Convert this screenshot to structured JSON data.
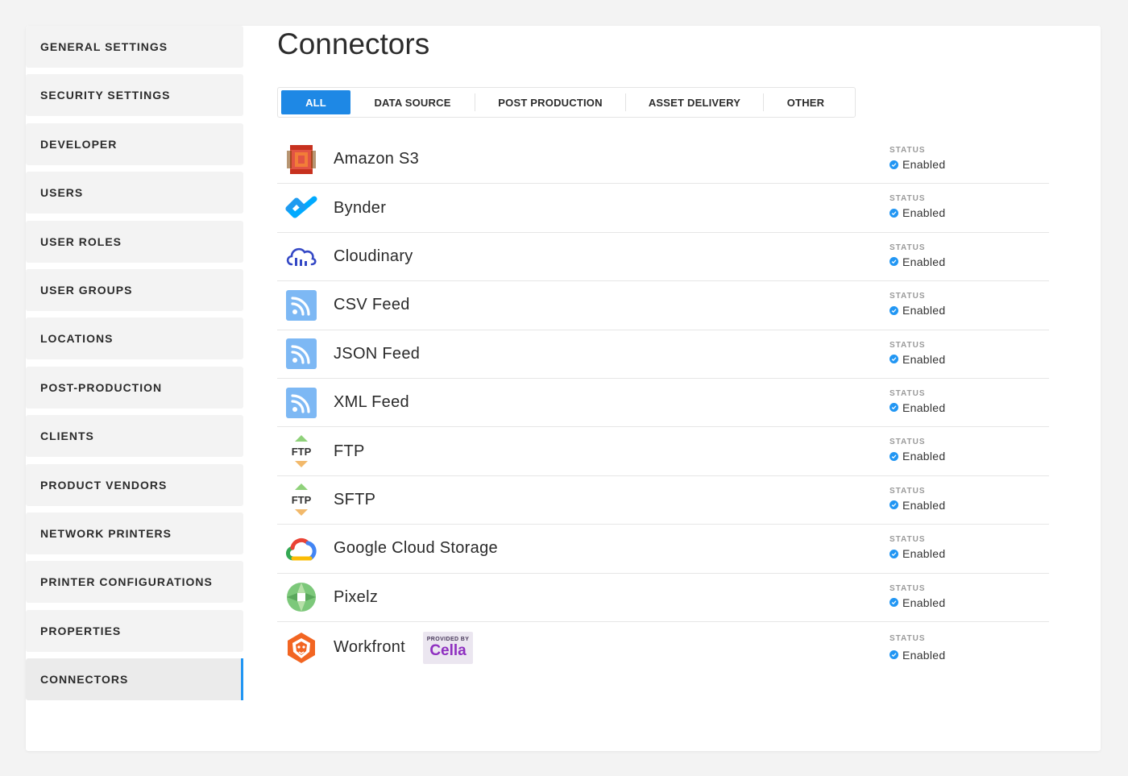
{
  "sidebar": {
    "items": [
      {
        "label": "GENERAL SETTINGS"
      },
      {
        "label": "SECURITY SETTINGS"
      },
      {
        "label": "DEVELOPER"
      },
      {
        "label": "USERS"
      },
      {
        "label": "USER ROLES"
      },
      {
        "label": "USER GROUPS"
      },
      {
        "label": "LOCATIONS"
      },
      {
        "label": "POST-PRODUCTION"
      },
      {
        "label": "CLIENTS"
      },
      {
        "label": "PRODUCT VENDORS"
      },
      {
        "label": "NETWORK PRINTERS"
      },
      {
        "label": "PRINTER CONFIGURATIONS"
      },
      {
        "label": "PROPERTIES"
      },
      {
        "label": "CONNECTORS"
      }
    ],
    "active": "CONNECTORS",
    "accent_color": "#2196f3"
  },
  "main": {
    "title": "Connectors",
    "tabs": [
      {
        "label": "ALL"
      },
      {
        "label": "DATA SOURCE"
      },
      {
        "label": "POST PRODUCTION"
      },
      {
        "label": "ASSET DELIVERY"
      },
      {
        "label": "OTHER"
      }
    ],
    "active_tab": "ALL",
    "connectors": [
      {
        "name": "Amazon S3",
        "icon": "amazon-s3-icon",
        "status_label": "STATUS",
        "status": "Enabled"
      },
      {
        "name": "Bynder",
        "icon": "bynder-icon",
        "status_label": "STATUS",
        "status": "Enabled"
      },
      {
        "name": "Cloudinary",
        "icon": "cloudinary-icon",
        "status_label": "STATUS",
        "status": "Enabled"
      },
      {
        "name": "CSV Feed",
        "icon": "rss-feed-icon",
        "status_label": "STATUS",
        "status": "Enabled"
      },
      {
        "name": "JSON Feed",
        "icon": "rss-feed-icon",
        "status_label": "STATUS",
        "status": "Enabled"
      },
      {
        "name": "XML Feed",
        "icon": "rss-feed-icon",
        "status_label": "STATUS",
        "status": "Enabled"
      },
      {
        "name": "FTP",
        "icon": "ftp-icon",
        "icon_text": "FTP",
        "status_label": "STATUS",
        "status": "Enabled"
      },
      {
        "name": "SFTP",
        "icon": "ftp-icon",
        "icon_text": "FTP",
        "status_label": "STATUS",
        "status": "Enabled"
      },
      {
        "name": "Google Cloud Storage",
        "icon": "google-cloud-icon",
        "status_label": "STATUS",
        "status": "Enabled"
      },
      {
        "name": "Pixelz",
        "icon": "pixelz-icon",
        "status_label": "STATUS",
        "status": "Enabled"
      },
      {
        "name": "Workfront",
        "icon": "workfront-icon",
        "status_label": "STATUS",
        "status": "Enabled",
        "badge": {
          "top": "PROVIDED BY",
          "brand": "Cella"
        }
      }
    ],
    "tab_active_color": "#1e88e5",
    "status_color": "#2196f3"
  }
}
